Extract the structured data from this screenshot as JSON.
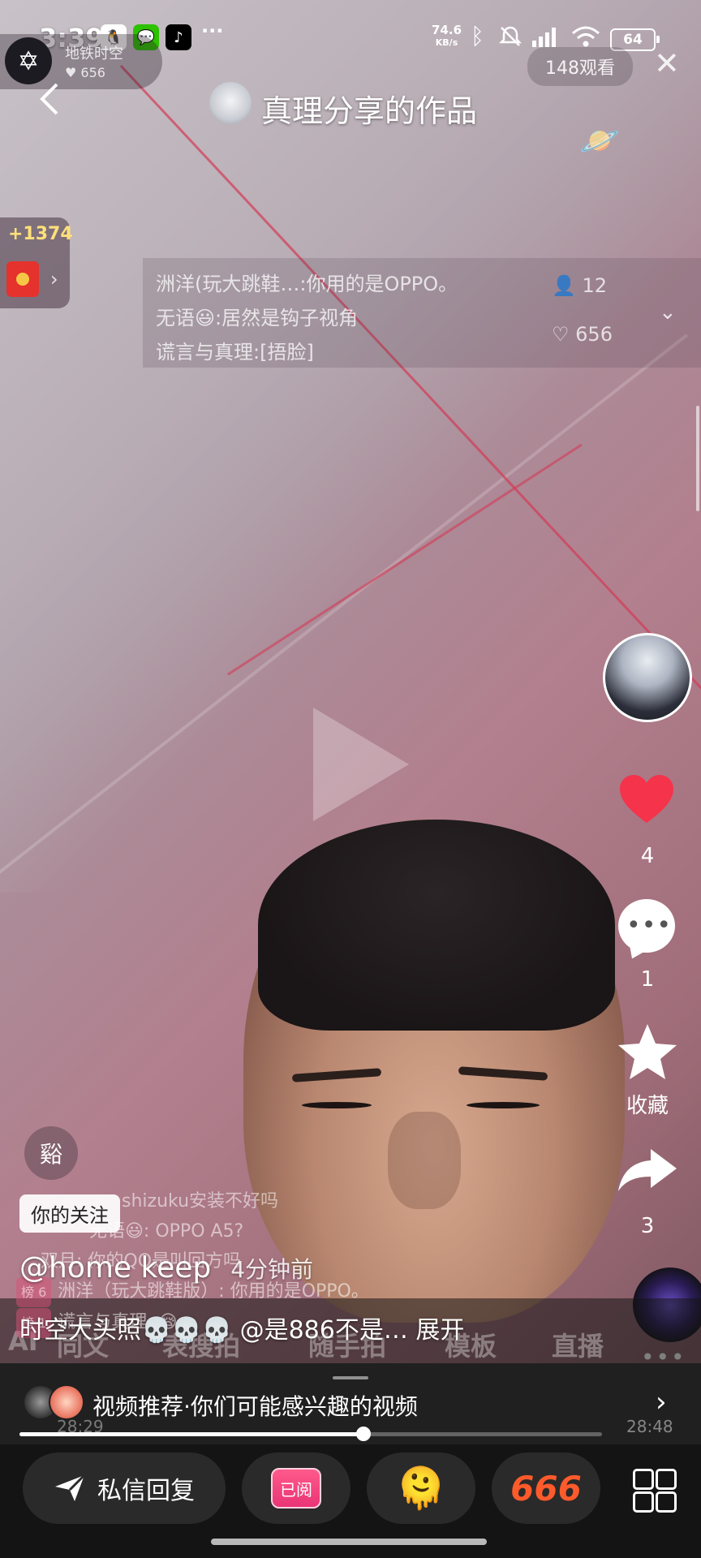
{
  "status_bar": {
    "time": "3:39",
    "net_speed_value": "74.6",
    "net_speed_unit": "KB/s",
    "battery": "64",
    "icons": [
      "qq-icon",
      "wechat-icon",
      "tiktok-icon",
      "more-icon",
      "bluetooth-icon",
      "mute-icon",
      "signal-icon",
      "wifi-icon",
      "battery-icon"
    ],
    "more": "···"
  },
  "live": {
    "name": "地铁时空",
    "likes": "♥ 656",
    "viewers": "148观看"
  },
  "header": {
    "title": "真理分享的作品"
  },
  "red_packet": {
    "count": "+1374"
  },
  "chat_top": {
    "lines": [
      "洲洋(玩大跳鞋…:你用的是OPPO。",
      "无语😃:居然是钩子视角",
      "谎言与真理:[捂脸]"
    ],
    "viewers_stat": "12",
    "likes_stat": "656"
  },
  "right_rail": {
    "like_count": "4",
    "comment_count": "1",
    "favorite_label": "收藏",
    "share_count": "3"
  },
  "overlay": {
    "gift_badge": "谿",
    "follow_tag": "你的关注",
    "bg_chat": [
      {
        "lv": "",
        "text": "shizuku安装不好吗"
      },
      {
        "lv": "",
        "text": "无语😃:  OPPO A5?"
      },
      {
        "lv": "",
        "text": "双月:  你的QQ是叫回方吗"
      },
      {
        "lv": "榜 6",
        "text": "洲洋（玩大跳鞋版）:  你用的是OPPO。"
      },
      {
        "lv": "榜 1",
        "text": "谎言与真理:  😪"
      }
    ],
    "bg_tabs": [
      "AI",
      "同文",
      "表搜拍",
      "随手拍",
      "模板",
      "直播"
    ],
    "author": "@home keep",
    "time_ago": "4分钟前",
    "description": "时空大头照💀💀💀 @是886不是… 展开"
  },
  "recommend": {
    "text": "视频推荐·你们可能感兴趣的视频",
    "time_left": "28:29",
    "time_right": "28:48",
    "progress": 0.59
  },
  "bottom_bar": {
    "reply_label": "私信回复",
    "read_badge": "已阅",
    "emoji": "🫠",
    "six": "666"
  },
  "colors": {
    "like": "#f5334a",
    "dark_bar": "#141414"
  }
}
